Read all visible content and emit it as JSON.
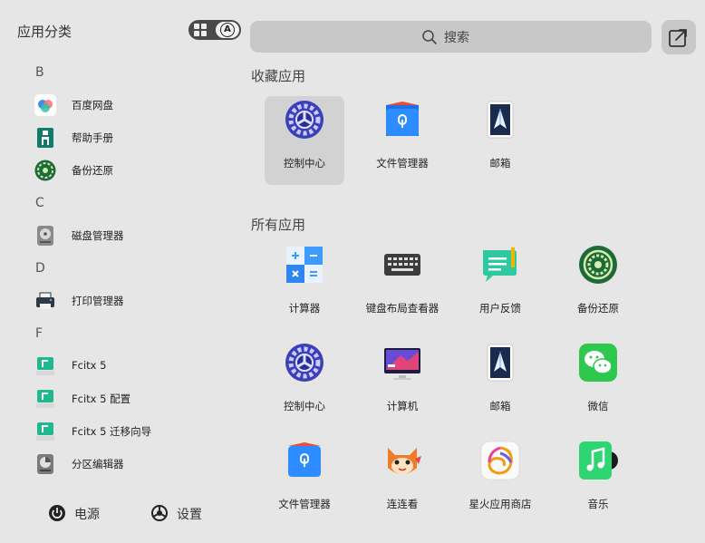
{
  "sidebar": {
    "title": "应用分类",
    "view_toggle_letter": "A",
    "groups": [
      {
        "letter": "B",
        "items": [
          {
            "label": "百度网盘",
            "icon": "baidu-netdisk-icon"
          },
          {
            "label": "帮助手册",
            "icon": "help-manual-icon"
          },
          {
            "label": "备份还原",
            "icon": "backup-restore-icon"
          }
        ]
      },
      {
        "letter": "C",
        "items": [
          {
            "label": "磁盘管理器",
            "icon": "disk-manager-icon"
          }
        ]
      },
      {
        "letter": "D",
        "items": [
          {
            "label": "打印管理器",
            "icon": "printer-icon"
          }
        ]
      },
      {
        "letter": "F",
        "items": [
          {
            "label": "Fcitx 5",
            "icon": "fcitx-icon"
          },
          {
            "label": "Fcitx 5 配置",
            "icon": "fcitx-config-icon"
          },
          {
            "label": "Fcitx 5 迁移向导",
            "icon": "fcitx-migrator-icon"
          },
          {
            "label": "分区编辑器",
            "icon": "partition-editor-icon"
          }
        ]
      }
    ],
    "power_label": "电源",
    "settings_label": "设置"
  },
  "search": {
    "placeholder": "搜索"
  },
  "favorites": {
    "title": "收藏应用",
    "apps": [
      {
        "label": "控制中心",
        "icon": "control-center-icon",
        "selected": true
      },
      {
        "label": "文件管理器",
        "icon": "file-manager-icon"
      },
      {
        "label": "邮箱",
        "icon": "mail-icon"
      }
    ]
  },
  "all_apps": {
    "title": "所有应用",
    "apps": [
      {
        "label": "计算器",
        "icon": "calculator-icon"
      },
      {
        "label": "键盘布局查看器",
        "icon": "keyboard-icon"
      },
      {
        "label": "用户反馈",
        "icon": "feedback-icon"
      },
      {
        "label": "备份还原",
        "icon": "backup-restore-icon"
      },
      {
        "label": "控制中心",
        "icon": "control-center-icon"
      },
      {
        "label": "计算机",
        "icon": "computer-icon"
      },
      {
        "label": "邮箱",
        "icon": "mail-icon"
      },
      {
        "label": "微信",
        "icon": "wechat-icon"
      },
      {
        "label": "文件管理器",
        "icon": "file-manager-icon"
      },
      {
        "label": "连连看",
        "icon": "lianliankan-icon"
      },
      {
        "label": "星火应用商店",
        "icon": "spark-store-icon"
      },
      {
        "label": "音乐",
        "icon": "music-icon"
      }
    ]
  },
  "colors": {
    "background": "#e6e6e6",
    "search_bg": "#c8c8c8",
    "selected_bg": "#d2d2d2"
  }
}
